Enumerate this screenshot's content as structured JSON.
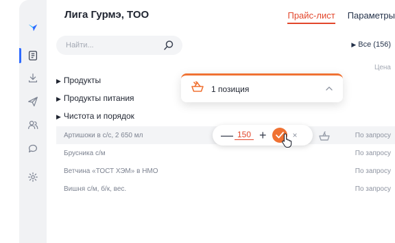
{
  "company": {
    "name": "Лига Гурмэ, ТОО"
  },
  "tabs": [
    {
      "label": "Прайс-лист",
      "active": true
    },
    {
      "label": "Параметры",
      "active": false
    }
  ],
  "search": {
    "placeholder": "Найти..."
  },
  "filter": {
    "all_label": "Все (156)"
  },
  "table": {
    "price_header": "Цена"
  },
  "categories": [
    {
      "label": "Продукты"
    },
    {
      "label": "Продукты питания"
    },
    {
      "label": "Чистота и порядок"
    }
  ],
  "items": [
    {
      "name": "Артишоки в с/с, 2 650 мл",
      "price": "По запросу"
    },
    {
      "name": "Брусника с/м",
      "price": "По запросу"
    },
    {
      "name": "Ветчина «ТОСТ ХЭМ» в НМО",
      "price": "По запросу"
    },
    {
      "name": "Вишня с/м, б/к, вес.",
      "price": "По запросу"
    }
  ],
  "stepper": {
    "minus": "—",
    "quantity": "150",
    "plus": "+",
    "close": "×"
  },
  "cart_popup": {
    "text": "1 позиция"
  },
  "sidebar": {
    "icons": [
      "logo-icon",
      "price-list-icon",
      "download-icon",
      "send-icon",
      "users-icon",
      "chat-icon",
      "settings-icon"
    ],
    "active": "price-list-icon"
  },
  "colors": {
    "accent": "#e2452a",
    "orange": "#f07233",
    "brand_blue": "#2f6bff",
    "sidebar_bg": "#f1f2f4",
    "highlight_row": "#f3f4f6"
  }
}
